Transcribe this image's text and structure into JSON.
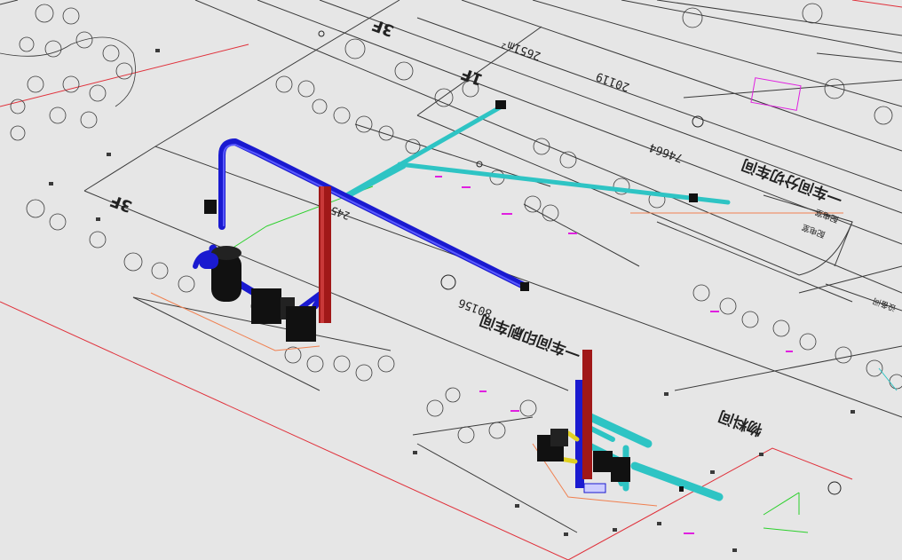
{
  "drawing": {
    "colors": {
      "background": "#e6e6e6",
      "linework": "#3a3a3a",
      "boundary_red": "#e0303a",
      "pipe_blue": "#1a1ad0",
      "pipe_cyan": "#2ec4c4",
      "riser_red": "#a01818",
      "equipment": "#111111",
      "green_line": "#2bd02b",
      "magenta": "#e020e0",
      "orange": "#f08050",
      "yellow": "#e0d020"
    },
    "labels": {
      "floor_3f_a": "3F",
      "floor_3f_b": "3F",
      "floor_1f": "1F",
      "area_2651": "2651m²",
      "dim_20119": "20119",
      "dim_74664": "74664",
      "dim_80156": "80156",
      "dim_245": "245",
      "workshop_a": "一车间分切车间",
      "workshop_b": "一车间印刷车间",
      "workshop_c": "物料间",
      "box_a": "配电室",
      "box_b": "配电室",
      "box_c": "设备间"
    }
  }
}
